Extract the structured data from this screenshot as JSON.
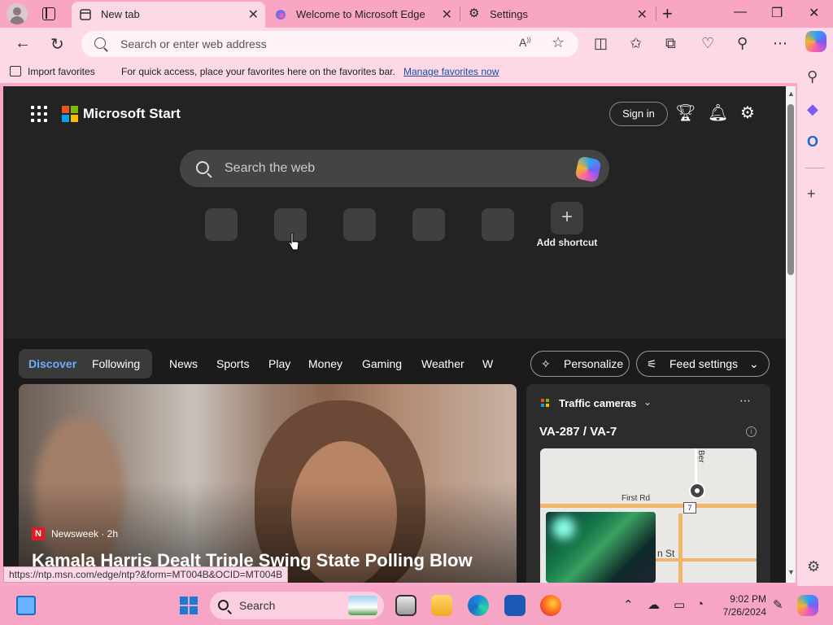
{
  "tabs": [
    {
      "label": "New tab",
      "active": true
    },
    {
      "label": "Welcome to Microsoft Edge",
      "active": false
    },
    {
      "label": "Settings",
      "active": false
    }
  ],
  "toolbar": {
    "address_placeholder": "Search or enter web address"
  },
  "favorites_bar": {
    "import_label": "Import favorites",
    "message": "For quick access, place your favorites here on the favorites bar.",
    "manage_link": "Manage favorites now"
  },
  "page": {
    "brand": "Microsoft Start",
    "sign_in": "Sign in",
    "search_placeholder": "Search the web",
    "add_shortcut": "Add shortcut",
    "feed": {
      "discover": "Discover",
      "following": "Following",
      "categories": [
        "News",
        "Sports",
        "Play",
        "Money",
        "Gaming",
        "Weather",
        "W"
      ],
      "personalize": "Personalize",
      "feed_settings": "Feed settings"
    },
    "hero": {
      "source": "Newsweek · 2h",
      "source_logo": "N",
      "headline": "Kamala Harris Dealt Triple Swing State Polling Blow"
    },
    "traffic": {
      "title": "Traffic cameras",
      "road": "VA-287 / VA-7",
      "map_labels": {
        "street1": "First Rd",
        "street2": "n St",
        "route": "7",
        "vertical": "Ber"
      }
    }
  },
  "status_url": "https://ntp.msn.com/edge/ntp?&form=MT004B&OCID=MT004B",
  "taskbar": {
    "search_label": "Search",
    "time": "9:02 PM",
    "date": "7/26/2024"
  },
  "colors": {
    "accent_pink": "#f9a6c4",
    "page_bg": "#232323",
    "link_blue": "#1a4fa0",
    "discover_blue": "#6aaeff"
  }
}
